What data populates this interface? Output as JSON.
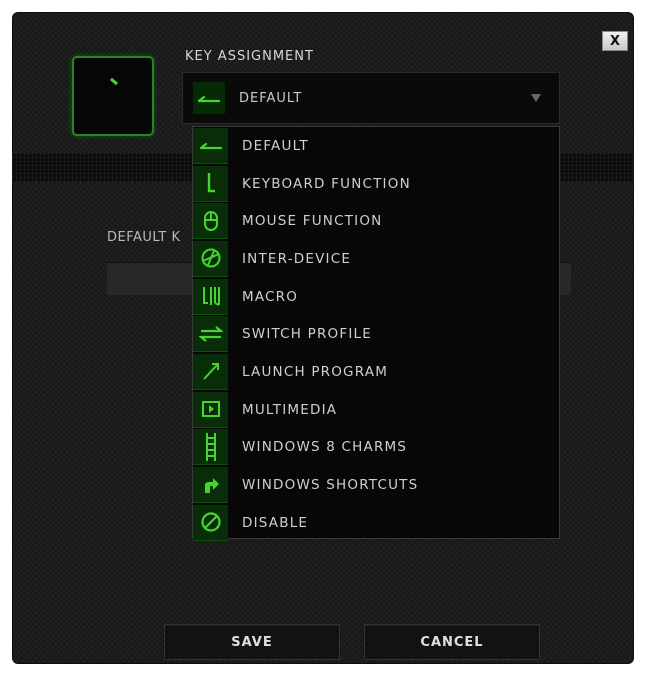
{
  "close_label": "X",
  "key_assignment": {
    "title": "KEY ASSIGNMENT",
    "selected": "DEFAULT",
    "selected_icon": "arrow-left-icon"
  },
  "default_key_label": "DEFAULT K",
  "dropdown": {
    "options": [
      {
        "label": "DEFAULT",
        "icon": "default-arrow-icon"
      },
      {
        "label": "KEYBOARD FUNCTION",
        "icon": "keyboard-function-icon"
      },
      {
        "label": "MOUSE FUNCTION",
        "icon": "mouse-icon"
      },
      {
        "label": "INTER-DEVICE",
        "icon": "inter-device-icon"
      },
      {
        "label": "MACRO",
        "icon": "macro-icon"
      },
      {
        "label": "SWITCH PROFILE",
        "icon": "switch-profile-icon"
      },
      {
        "label": "LAUNCH PROGRAM",
        "icon": "launch-program-icon"
      },
      {
        "label": "MULTIMEDIA",
        "icon": "multimedia-icon"
      },
      {
        "label": "WINDOWS 8 CHARMS",
        "icon": "windows-charms-icon"
      },
      {
        "label": "WINDOWS SHORTCUTS",
        "icon": "windows-shortcuts-icon"
      },
      {
        "label": "DISABLE",
        "icon": "disable-icon"
      }
    ]
  },
  "buttons": {
    "save": "SAVE",
    "cancel": "CANCEL"
  },
  "colors": {
    "accent": "#44d62c",
    "background": "#1c1c1c"
  }
}
